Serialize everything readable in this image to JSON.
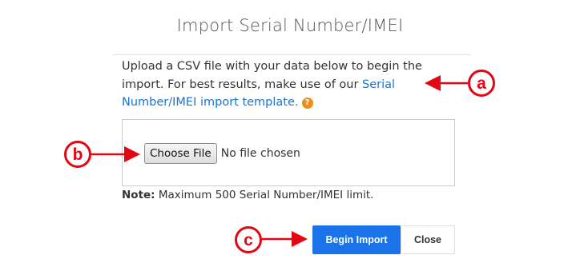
{
  "dialog": {
    "title": "Import Serial Number/IMEI",
    "intro_text": "Upload a CSV file with your data below to begin the import. For best results, make use of our ",
    "template_link": "Serial Number/IMEI import template.",
    "help_icon": "?",
    "file_input": {
      "button_label": "Choose File",
      "status": "No file chosen"
    },
    "note_label": "Note:",
    "note_text": " Maximum 500 Serial Number/IMEI limit.",
    "begin_label": "Begin Import",
    "close_label": "Close"
  },
  "callouts": {
    "a": "a",
    "b": "b",
    "c": "c"
  },
  "colors": {
    "accent": "#1a73e8",
    "link": "#1a73d6",
    "annotation": "#e30613",
    "help": "#f08c1a"
  },
  "icons": [
    "question-circle-icon",
    "arrow-icon"
  ]
}
